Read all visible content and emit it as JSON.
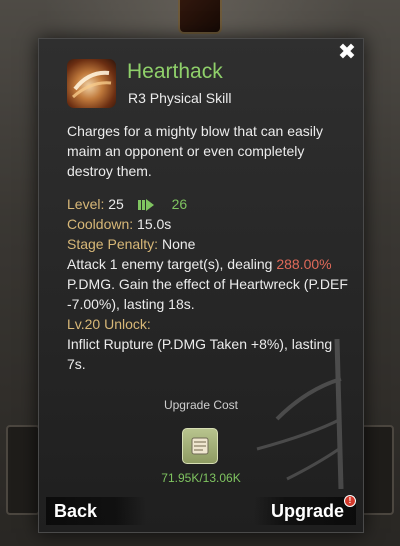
{
  "skill": {
    "name": "Hearthack",
    "type": "R3 Physical Skill",
    "description": "Charges for a mighty blow that can easily maim an opponent or even completely destroy them.",
    "icon": "sword-slash-icon"
  },
  "stats": {
    "level_label": "Level:",
    "level_current": "25",
    "level_next": "26",
    "cooldown_label": "Cooldown:",
    "cooldown_value": "15.0s",
    "penalty_label": "Stage Penalty:",
    "penalty_value": "None",
    "effect_pre": "Attack 1 enemy target(s), dealing ",
    "effect_pct": "288.00%",
    "effect_post": " P.DMG. Gain the effect of Heartwreck (P.DEF -7.00%), lasting 18s.",
    "unlock_label": "Lv.20 Unlock:",
    "unlock_text": "Inflict Rupture (P.DMG Taken +8%), lasting 7s."
  },
  "upgrade": {
    "title": "Upgrade Cost",
    "material_icon": "scroll-material-icon",
    "material_count": "71.95K/13.06K"
  },
  "buttons": {
    "back": "Back",
    "upgrade": "Upgrade",
    "alert": "!"
  },
  "colors": {
    "name_green": "#8fd06a",
    "label_gold": "#d8b878",
    "value_red": "#e06a5a",
    "next_level_green": "#7fc460"
  }
}
